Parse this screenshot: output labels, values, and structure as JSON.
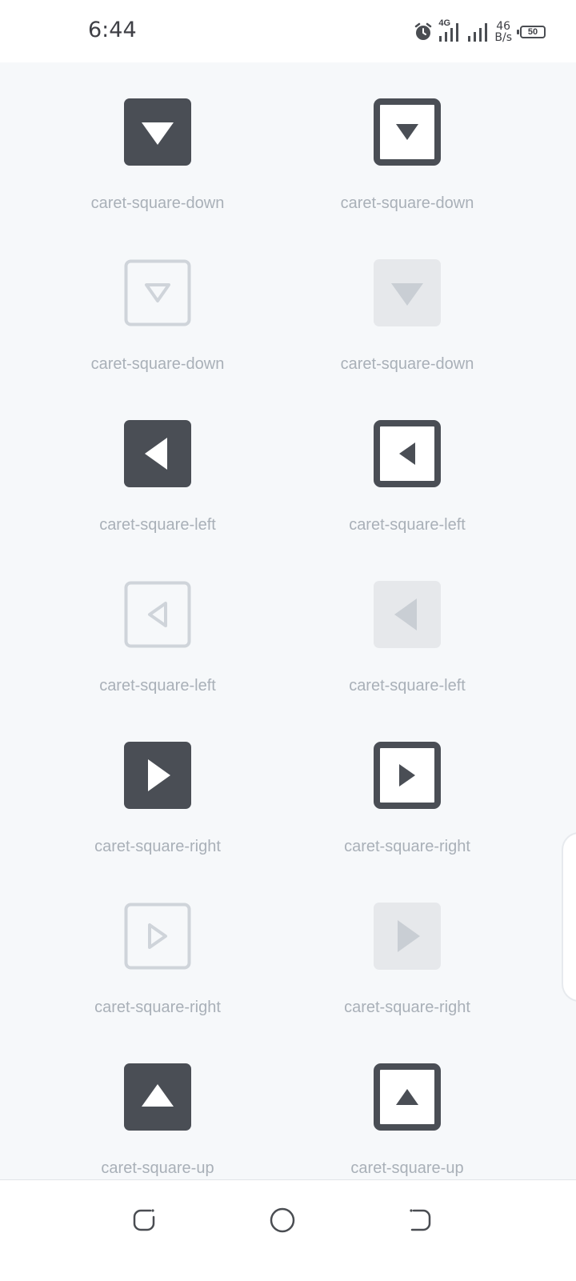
{
  "status_bar": {
    "time": "6:44",
    "network": "4G",
    "speed_value": "46",
    "speed_unit": "B/s",
    "battery": "50",
    "icons": [
      "alarm-icon",
      "signal-4g-icon",
      "signal-icon",
      "battery-icon"
    ]
  },
  "icons": [
    {
      "label": "caret-square-down",
      "direction": "down",
      "variant": "solid"
    },
    {
      "label": "caret-square-down",
      "direction": "down",
      "variant": "outline-thick"
    },
    {
      "label": "caret-square-down",
      "direction": "down",
      "variant": "outline-light"
    },
    {
      "label": "caret-square-down",
      "direction": "down",
      "variant": "filled-light"
    },
    {
      "label": "caret-square-left",
      "direction": "left",
      "variant": "solid"
    },
    {
      "label": "caret-square-left",
      "direction": "left",
      "variant": "outline-thick"
    },
    {
      "label": "caret-square-left",
      "direction": "left",
      "variant": "outline-light"
    },
    {
      "label": "caret-square-left",
      "direction": "left",
      "variant": "filled-light"
    },
    {
      "label": "caret-square-right",
      "direction": "right",
      "variant": "solid"
    },
    {
      "label": "caret-square-right",
      "direction": "right",
      "variant": "outline-thick"
    },
    {
      "label": "caret-square-right",
      "direction": "right",
      "variant": "outline-light"
    },
    {
      "label": "caret-square-right",
      "direction": "right",
      "variant": "filled-light"
    },
    {
      "label": "caret-square-up",
      "direction": "up",
      "variant": "solid"
    },
    {
      "label": "caret-square-up",
      "direction": "up",
      "variant": "outline-thick"
    }
  ],
  "nav_bar": {
    "icons": [
      "recent-apps-icon",
      "home-icon",
      "back-icon"
    ]
  },
  "colors": {
    "dark": "#4a4e55",
    "light_stroke": "#cfd4da",
    "light_fill": "#e6e8eb",
    "light_caret": "#c9ced4",
    "label": "#a9b0b8",
    "background": "#f6f8fa"
  }
}
